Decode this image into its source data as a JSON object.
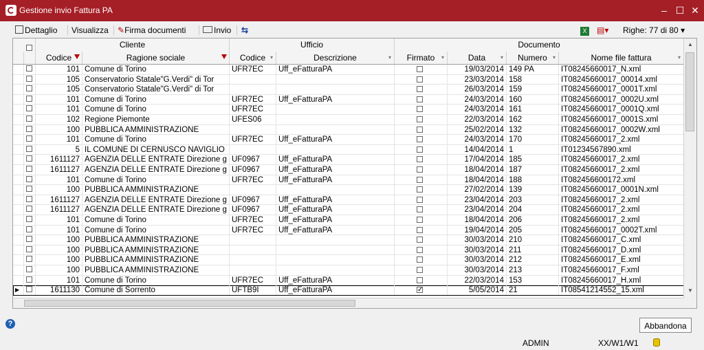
{
  "window": {
    "title": "Gestione invio Fattura PA"
  },
  "toolbar": {
    "dettaglio": "Dettaglio",
    "visualizza": "Visualizza",
    "firma": "Firma documenti",
    "invio": "Invio",
    "righe": "Righe: 77 di 80"
  },
  "groups": {
    "cliente": "Cliente",
    "ufficio": "Ufficio",
    "documento": "Documento"
  },
  "columns": {
    "codice": "Codice",
    "ragione": "Ragione sociale",
    "ucodice": "Codice",
    "descrizione": "Descrizione",
    "firmato": "Firmato",
    "data": "Data",
    "numero": "Numero",
    "nomefile": "Nome file fattura"
  },
  "rows": [
    {
      "codice": "101",
      "ragione": "Comune di Torino",
      "ucodice": "UFR7EC",
      "descrizione": "Uff_eFatturaPA",
      "firmato": false,
      "data": "19/03/2014",
      "numero": "149 PA",
      "file": "IT08245660017_N.xml"
    },
    {
      "codice": "105",
      "ragione": "Conservatorio Statale\"G.Verdi\" di Tor",
      "ucodice": "",
      "descrizione": "",
      "firmato": false,
      "data": "23/03/2014",
      "numero": "158",
      "file": "IT08245660017_00014.xml"
    },
    {
      "codice": "105",
      "ragione": "Conservatorio Statale\"G.Verdi\" di Tor",
      "ucodice": "",
      "descrizione": "",
      "firmato": false,
      "data": "26/03/2014",
      "numero": "159",
      "file": "IT08245660017_0001T.xml"
    },
    {
      "codice": "101",
      "ragione": "Comune di Torino",
      "ucodice": "UFR7EC",
      "descrizione": "Uff_eFatturaPA",
      "firmato": false,
      "data": "24/03/2014",
      "numero": "160",
      "file": "IT08245660017_0002U.xml"
    },
    {
      "codice": "101",
      "ragione": "Comune di Torino",
      "ucodice": "UFR7EC",
      "descrizione": "",
      "firmato": false,
      "data": "24/03/2014",
      "numero": "161",
      "file": "IT08245660017_0001Q.xml"
    },
    {
      "codice": "102",
      "ragione": "Regione Piemonte",
      "ucodice": "UFES06",
      "descrizione": "",
      "firmato": false,
      "data": "22/03/2014",
      "numero": "162",
      "file": "IT08245660017_0001S.xml"
    },
    {
      "codice": "100",
      "ragione": "PUBBLICA AMMINISTRAZIONE",
      "ucodice": "",
      "descrizione": "",
      "firmato": false,
      "data": "25/02/2014",
      "numero": "132",
      "file": "IT08245660017_0002W.xml"
    },
    {
      "codice": "101",
      "ragione": "Comune di Torino",
      "ucodice": "UFR7EC",
      "descrizione": "Uff_eFatturaPA",
      "firmato": false,
      "data": "24/03/2014",
      "numero": "170",
      "file": "IT08245660017_2.xml"
    },
    {
      "codice": "5",
      "ragione": "IL COMUNE DI CERNUSCO NAVIGLIO",
      "ucodice": "",
      "descrizione": "",
      "firmato": false,
      "data": "14/04/2014",
      "numero": "1",
      "file": "IT01234567890.xml"
    },
    {
      "codice": "1611127",
      "ragione": "AGENZIA DELLE ENTRATE Direzione g",
      "ucodice": "UF0967",
      "descrizione": "Uff_eFatturaPA",
      "firmato": false,
      "data": "17/04/2014",
      "numero": "185",
      "file": "IT08245660017_2.xml"
    },
    {
      "codice": "1611127",
      "ragione": "AGENZIA DELLE ENTRATE Direzione g",
      "ucodice": "UF0967",
      "descrizione": "Uff_eFatturaPA",
      "firmato": false,
      "data": "18/04/2014",
      "numero": "187",
      "file": "IT08245660017_2.xml"
    },
    {
      "codice": "101",
      "ragione": "Comune di Torino",
      "ucodice": "UFR7EC",
      "descrizione": "Uff_eFatturaPA",
      "firmato": false,
      "data": "18/04/2014",
      "numero": "188",
      "file": "IT082456600172.xml"
    },
    {
      "codice": "100",
      "ragione": "PUBBLICA AMMINISTRAZIONE",
      "ucodice": "",
      "descrizione": "",
      "firmato": false,
      "data": "27/02/2014",
      "numero": "139",
      "file": "IT08245660017_0001N.xml"
    },
    {
      "codice": "1611127",
      "ragione": "AGENZIA DELLE ENTRATE Direzione g",
      "ucodice": "UF0967",
      "descrizione": "Uff_eFatturaPA",
      "firmato": false,
      "data": "23/04/2014",
      "numero": "203",
      "file": "IT08245660017_2.xml"
    },
    {
      "codice": "1611127",
      "ragione": "AGENZIA DELLE ENTRATE Direzione g",
      "ucodice": "UF0967",
      "descrizione": "Uff_eFatturaPA",
      "firmato": false,
      "data": "23/04/2014",
      "numero": "204",
      "file": "IT08245660017_2.xml"
    },
    {
      "codice": "101",
      "ragione": "Comune di Torino",
      "ucodice": "UFR7EC",
      "descrizione": "Uff_eFatturaPA",
      "firmato": false,
      "data": "18/04/2014",
      "numero": "206",
      "file": "IT08245660017_2.xml"
    },
    {
      "codice": "101",
      "ragione": "Comune di Torino",
      "ucodice": "UFR7EC",
      "descrizione": "Uff_eFatturaPA",
      "firmato": false,
      "data": "19/04/2014",
      "numero": "205",
      "file": "IT08245660017_0002T.xml"
    },
    {
      "codice": "100",
      "ragione": "PUBBLICA AMMINISTRAZIONE",
      "ucodice": "",
      "descrizione": "",
      "firmato": false,
      "data": "30/03/2014",
      "numero": "210",
      "file": "IT08245660017_C.xml"
    },
    {
      "codice": "100",
      "ragione": "PUBBLICA AMMINISTRAZIONE",
      "ucodice": "",
      "descrizione": "",
      "firmato": false,
      "data": "30/03/2014",
      "numero": "211",
      "file": "IT08245660017_D.xml"
    },
    {
      "codice": "100",
      "ragione": "PUBBLICA AMMINISTRAZIONE",
      "ucodice": "",
      "descrizione": "",
      "firmato": false,
      "data": "30/03/2014",
      "numero": "212",
      "file": "IT08245660017_E.xml"
    },
    {
      "codice": "100",
      "ragione": "PUBBLICA AMMINISTRAZIONE",
      "ucodice": "",
      "descrizione": "",
      "firmato": false,
      "data": "30/03/2014",
      "numero": "213",
      "file": "IT08245660017_F.xml"
    },
    {
      "codice": "101",
      "ragione": "Comune di Torino",
      "ucodice": "UFR7EC",
      "descrizione": "Uff_eFatturaPA",
      "firmato": false,
      "data": "22/03/2014",
      "numero": "153",
      "file": "IT08245660017_H.xml"
    },
    {
      "codice": "1611130",
      "ragione": "Comune di Sorrento",
      "ucodice": "UFTB9I",
      "descrizione": "Uff_eFatturaPA",
      "firmato": true,
      "data": "5/05/2014",
      "numero": "21",
      "file": "IT08541214552_15.xml",
      "current": true
    }
  ],
  "footer": {
    "abbandona": "Abbandona",
    "user": "ADMIN",
    "path": "XX/W1/W1"
  }
}
